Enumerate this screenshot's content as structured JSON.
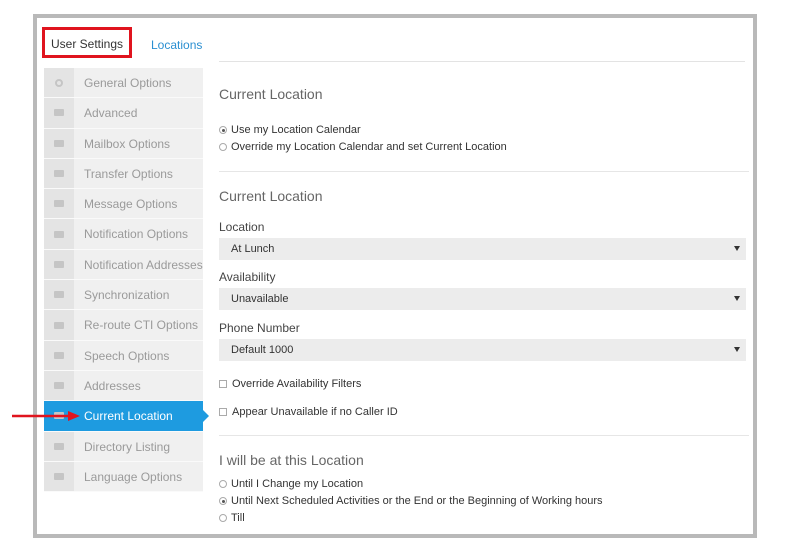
{
  "tabs": [
    {
      "label": "User Settings"
    },
    {
      "label": "Locations"
    }
  ],
  "sidebar": {
    "items": [
      {
        "label": "General Options",
        "icon": "gear-icon"
      },
      {
        "label": "Advanced",
        "icon": "envelope-icon"
      },
      {
        "label": "Mailbox Options",
        "icon": "envelope-icon"
      },
      {
        "label": "Transfer Options",
        "icon": "envelope-icon"
      },
      {
        "label": "Message Options",
        "icon": "envelope-icon"
      },
      {
        "label": "Notification Options",
        "icon": "envelope-icon"
      },
      {
        "label": "Notification Addresses",
        "icon": "envelope-icon"
      },
      {
        "label": "Synchronization",
        "icon": "envelope-icon"
      },
      {
        "label": "Re-route CTI Options",
        "icon": "envelope-icon"
      },
      {
        "label": "Speech Options",
        "icon": "envelope-icon"
      },
      {
        "label": "Addresses",
        "icon": "envelope-icon"
      },
      {
        "label": "Current Location",
        "icon": "envelope-icon",
        "active": true
      },
      {
        "label": "Directory Listing",
        "icon": "envelope-icon"
      },
      {
        "label": "Language Options",
        "icon": "envelope-icon"
      }
    ]
  },
  "main": {
    "section1": {
      "title": "Current Location",
      "options": [
        {
          "label": "Use my Location Calendar",
          "selected": true
        },
        {
          "label": "Override my Location Calendar and set Current Location",
          "selected": false
        }
      ]
    },
    "section2": {
      "title": "Current Location",
      "location_label": "Location",
      "location_value": "At Lunch",
      "availability_label": "Availability",
      "availability_value": "Unavailable",
      "phone_label": "Phone Number",
      "phone_value": "Default 1000",
      "override_filters_label": "Override Availability Filters",
      "appear_unavailable_label": "Appear Unavailable if no Caller ID"
    },
    "section3": {
      "title": "I will be at this Location",
      "options": [
        {
          "label": "Until I Change my Location",
          "selected": false
        },
        {
          "label": "Until Next Scheduled Activities or the End or the Beginning of Working hours",
          "selected": true
        },
        {
          "label": "Till",
          "selected": false
        }
      ]
    }
  },
  "colors": {
    "accent": "#1e9be0",
    "highlight": "#e0141e",
    "link": "#2a8fd1"
  }
}
